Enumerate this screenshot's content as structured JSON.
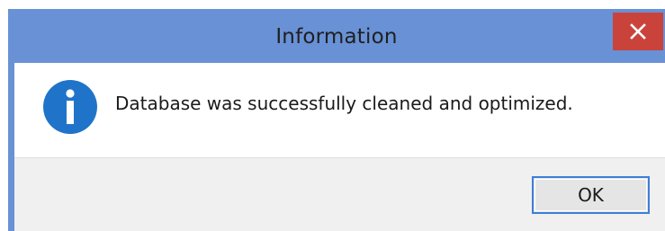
{
  "dialog": {
    "title": "Information",
    "message": "Database was successfully cleaned and optimized.",
    "icon": "info-icon",
    "ok_label": "OK",
    "close_icon": "close-icon"
  },
  "colors": {
    "frame": "#6891d6",
    "close_button": "#c9433b",
    "icon_blue": "#1f74c9",
    "button_border": "#3c7fd8",
    "button_area": "#f0f0f0"
  }
}
